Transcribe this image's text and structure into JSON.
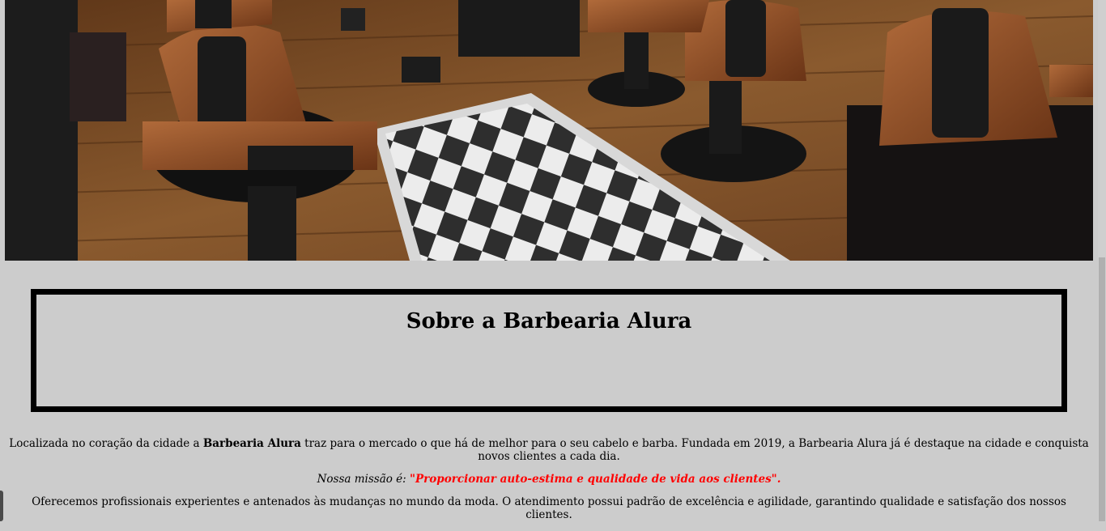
{
  "hero": {
    "image_name": "barbershop-interior-photo",
    "colors": {
      "wood": "#7a4a24",
      "leather": "#8a4a26",
      "black": "#1a1a1a",
      "tile_light": "#eeeeee",
      "tile_dark": "#333333"
    }
  },
  "about": {
    "title": "Sobre a Barbearia Alura"
  },
  "intro": {
    "before": "Localizada no coração da cidade a ",
    "brand": "Barbearia Alura",
    "after": " traz para o mercado o que há de melhor para o seu cabelo e barba. Fundada em 2019, a Barbearia Alura já é destaque na cidade e conquista novos clientes a cada dia."
  },
  "mission": {
    "label": "Nossa missão é: ",
    "quote": "\"Proporcionar auto-estima e qualidade de vida aos clientes\"."
  },
  "services": {
    "text": "Oferecemos profissionais experientes e antenados às mudanças no mundo da moda. O atendimento possui padrão de excelência e agilidade, garantindo qualidade e satisfação dos nossos clientes."
  },
  "colors": {
    "page_background": "#cccccc",
    "mission_red": "#ff0000"
  }
}
